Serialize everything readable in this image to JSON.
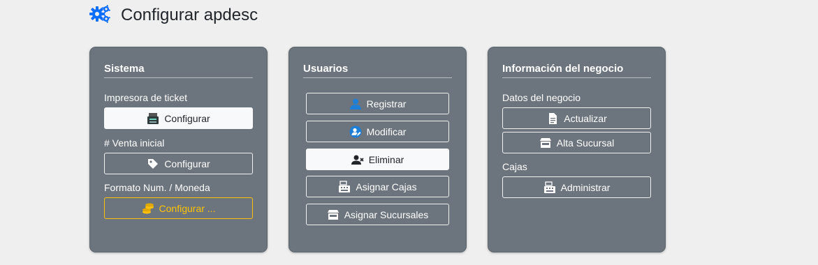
{
  "page": {
    "title": "Configurar apdesc",
    "icon": "gears-icon"
  },
  "colors": {
    "accent": "#0d6efd",
    "card_bg": "#6c757d",
    "warning": "#ffc107",
    "page_bg": "#efefef"
  },
  "sistema": {
    "title": "Sistema",
    "ticket_label": "Impresora de ticket",
    "ticket_button": "Configurar",
    "venta_label": "# Venta inicial",
    "venta_button": "Configurar",
    "formato_label": "Formato Num. / Moneda",
    "formato_button": "Configurar ..."
  },
  "usuarios": {
    "title": "Usuarios",
    "registrar": "Registrar",
    "modificar": "Modificar",
    "eliminar": "Eliminar",
    "asignar_cajas": "Asignar Cajas",
    "asignar_sucursales": "Asignar Sucursales"
  },
  "negocio": {
    "title": "Información del negocio",
    "datos_label": "Datos del negocio",
    "actualizar": "Actualizar",
    "alta_sucursal": "Alta Sucursal",
    "cajas_label": "Cajas",
    "administrar": "Administrar"
  }
}
